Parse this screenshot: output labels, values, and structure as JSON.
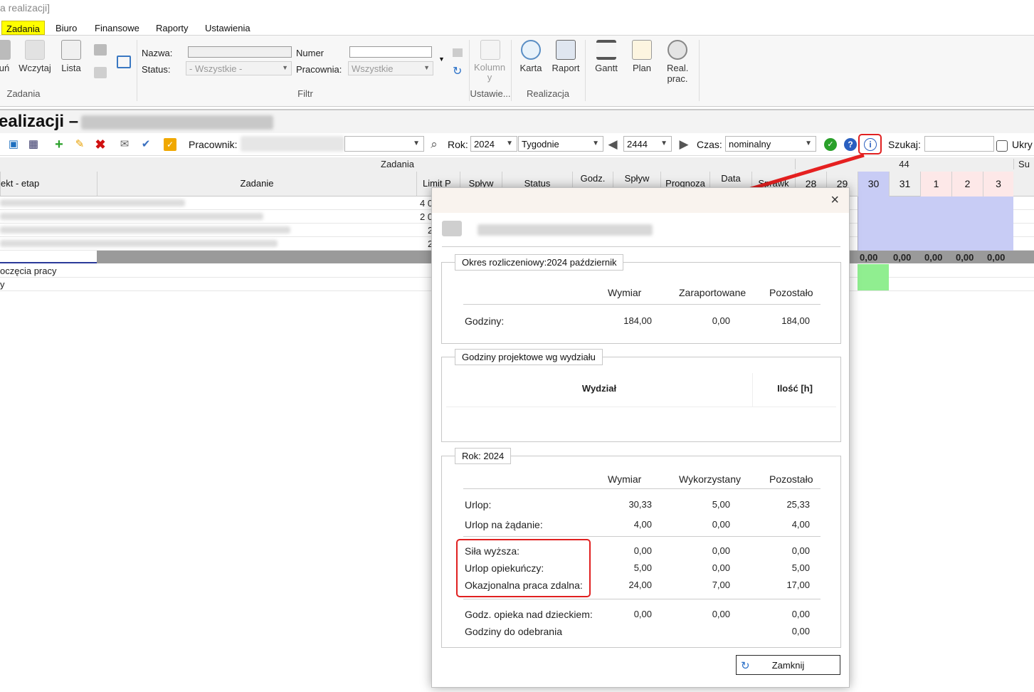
{
  "window": {
    "title": "a realizacji]"
  },
  "menu": [
    "Zadania",
    "Biuro",
    "Finansowe",
    "Raporty",
    "Ustawienia"
  ],
  "ribbon": {
    "btn_un": "uń",
    "btn_wczytaj": "Wczytaj",
    "btn_lista": "Lista",
    "grp_zadania": "Zadania",
    "lbl_nazwa": "Nazwa:",
    "lbl_numer": "Numer",
    "lbl_status": "Status:",
    "status_value": "- Wszystkie -",
    "lbl_pracownia": "Pracownia:",
    "pracownia_value": "Wszystkie",
    "grp_filtr": "Filtr",
    "btn_kolumny": "Kolumn y",
    "grp_ustawienia": "Ustawie...",
    "btn_karta": "Karta",
    "btn_raport": "Raport",
    "grp_realizacja": "Realizacja",
    "btn_gantt": "Gantt",
    "btn_plan": "Plan",
    "btn_real_prac": "Real. prac."
  },
  "header2": {
    "title": "ealizacji –"
  },
  "toolbar": {
    "lbl_pracownik": "Pracownik:",
    "lbl_rok": "Rok:",
    "rok_value": "2024",
    "period_value": "Tygodnie",
    "week_value": "2444",
    "lbl_czas": "Czas:",
    "czas_value": "nominalny",
    "lbl_szukaj": "Szukaj:",
    "lbl_ukryj": "Ukry"
  },
  "grid": {
    "group_zadania": "Zadania",
    "week_num": "44",
    "su": "Su",
    "col_projekt": "ekt - etap",
    "col_zadanie": "Zadanie",
    "col_limit": "Limit P",
    "col_splyw": "Spływ",
    "col_status": "Status",
    "col_godz": "Godz.",
    "col_splyw2": "Spływ",
    "col_prognoza": "Prognoza",
    "col_data": "Data",
    "col_sprawk": "Sprawk",
    "days": [
      "28",
      "29",
      "30",
      "31",
      "1",
      "2",
      "3"
    ],
    "row_limits": [
      "4 0",
      "2 0",
      "2",
      "2"
    ],
    "total_values": [
      "0,00",
      "0,00",
      "0,00",
      "0,00",
      "0,00",
      "0,00"
    ],
    "row_rozpoczecia": "oczęcia pracy",
    "row_y": "y"
  },
  "modal": {
    "close": "×",
    "s1_legend": "Okres rozliczeniowy:2024  październik",
    "s1_headers": [
      "Wymiar",
      "Zaraportowane",
      "Pozostało"
    ],
    "s1_row": {
      "label": "Godziny:",
      "values": [
        "184,00",
        "0,00",
        "184,00"
      ]
    },
    "s2_legend": "Godziny projektowe wg wydziału",
    "s2_headers": [
      "Wydział",
      "Ilość [h]"
    ],
    "s3_legend": "Rok: 2024",
    "s3_headers": [
      "Wymiar",
      "Wykorzystany",
      "Pozostało"
    ],
    "s3_rows": [
      {
        "label": "Urlop:",
        "values": [
          "30,33",
          "5,00",
          "25,33"
        ]
      },
      {
        "label": "Urlop na żądanie:",
        "values": [
          "4,00",
          "0,00",
          "4,00"
        ]
      },
      {
        "label": "Siła wyższa:",
        "values": [
          "0,00",
          "0,00",
          "0,00"
        ]
      },
      {
        "label": "Urlop opiekuńczy:",
        "values": [
          "5,00",
          "0,00",
          "5,00"
        ]
      },
      {
        "label": "Okazjonalna praca zdalna:",
        "values": [
          "24,00",
          "7,00",
          "17,00"
        ]
      },
      {
        "label": "Godz. opieka nad dzieckiem:",
        "values": [
          "0,00",
          "0,00",
          "0,00"
        ]
      },
      {
        "label": "Godziny do odebrania",
        "values": [
          "",
          "",
          "0,00"
        ]
      }
    ],
    "btn_zamknij": "Zamknij"
  },
  "colors": {
    "accent_red": "#e02020",
    "highlight_yellow": "#ffff00",
    "day_blue": "#c8ccf5",
    "day_pink": "#fde8e8",
    "green": "#90ee90"
  }
}
